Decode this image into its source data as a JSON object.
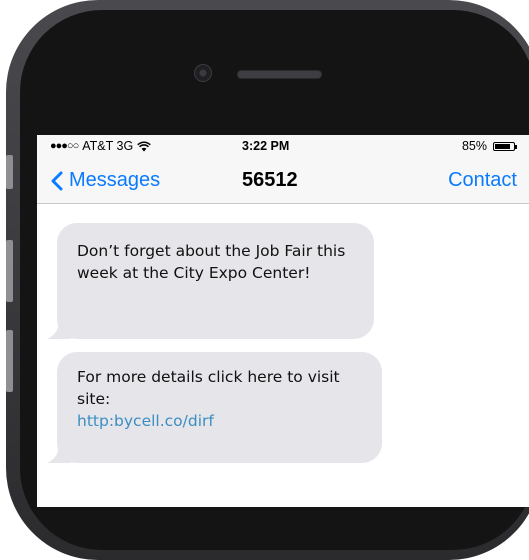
{
  "status_bar": {
    "signal_dots": "●●●○○",
    "carrier": "AT&T 3G",
    "time": "3:22 PM",
    "battery_percent": "85%",
    "battery_level": 0.85
  },
  "nav": {
    "back_label": "Messages",
    "title": "56512",
    "action_label": "Contact"
  },
  "messages": [
    {
      "text": "Don’t forget about the Job Fair this week at the City Expo Center!"
    },
    {
      "text": "For more details click here to visit site:",
      "link": "http:bycell.co/dirf"
    }
  ],
  "colors": {
    "ios_blue": "#0a7aff",
    "bubble_gray": "#e5e5ea",
    "link": "#3c8ec2"
  }
}
